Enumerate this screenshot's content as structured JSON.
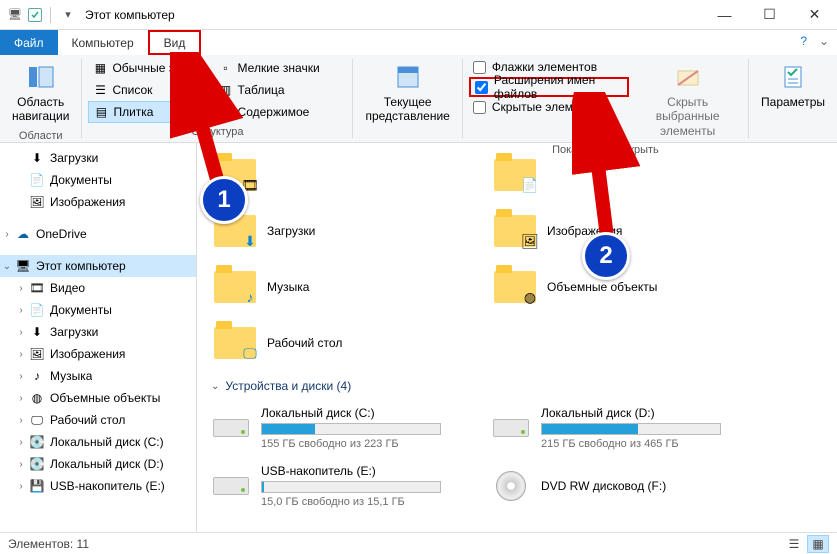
{
  "window": {
    "title": "Этот компьютер"
  },
  "tabs": {
    "file": "Файл",
    "computer": "Компьютер",
    "view": "Вид"
  },
  "ribbon": {
    "nav": {
      "label": "Область\nнавигации",
      "group": "Области"
    },
    "layout": {
      "normal": "Обычные значки",
      "small": "Мелкие значки",
      "list": "Список",
      "table": "Таблица",
      "tile": "Плитка",
      "content": "Содержимое",
      "group": "Структура"
    },
    "current": {
      "label": "Текущее\nпредставление"
    },
    "show": {
      "flags": "Флажки элементов",
      "ext": "Расширения имен файлов",
      "hidden": "Скрытые элементы",
      "hide_btn": "Скрыть выбранные\nэлементы",
      "group": "Показать или скрыть"
    },
    "params": "Параметры"
  },
  "sidebar": {
    "downloads": "Загрузки",
    "documents": "Документы",
    "pictures": "Изображения",
    "onedrive": "OneDrive",
    "thispc": "Этот компьютер",
    "video": "Видео",
    "documents2": "Документы",
    "downloads2": "Загрузки",
    "pictures2": "Изображения",
    "music": "Музыка",
    "objects3d": "Объемные объекты",
    "desktop": "Рабочий стол",
    "diskc": "Локальный диск (C:)",
    "diskd": "Локальный диск (D:)",
    "usbe": "USB-накопитель (E:)"
  },
  "folders": {
    "downloads": "Загрузки",
    "pictures": "Изображения",
    "music": "Музыка",
    "objects3d": "Объемные объекты",
    "desktop": "Рабочий стол"
  },
  "section": "Устройства и диски (4)",
  "drives": {
    "c": {
      "name": "Локальный диск (C:)",
      "info": "155 ГБ свободно из 223 ГБ",
      "pct": 30
    },
    "d": {
      "name": "Локальный диск (D:)",
      "info": "215 ГБ свободно из 465 ГБ",
      "pct": 54
    },
    "e": {
      "name": "USB-накопитель (E:)",
      "info": "15,0 ГБ свободно из 15,1 ГБ",
      "pct": 1
    },
    "f": {
      "name": "DVD RW дисковод (F:)"
    }
  },
  "status": "Элементов: 11",
  "callout": {
    "one": "1",
    "two": "2"
  }
}
